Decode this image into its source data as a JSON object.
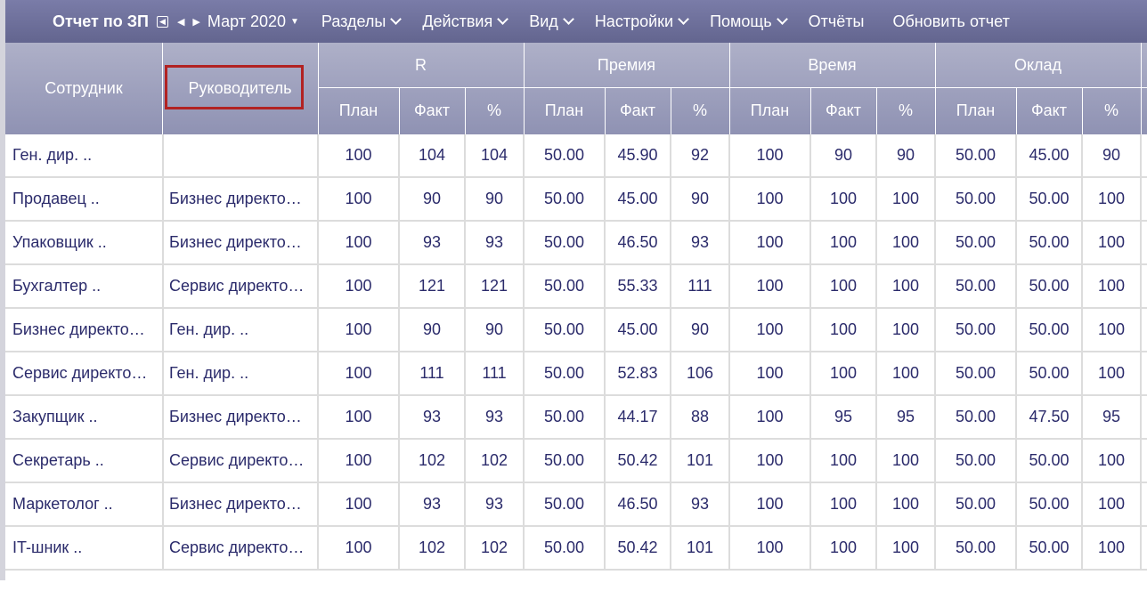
{
  "toolbar": {
    "title": "Отчет по ЗП",
    "period": "Март 2020",
    "menu": [
      "Разделы",
      "Действия",
      "Вид",
      "Настройки",
      "Помощь",
      "Отчёты",
      "Обновить отчет"
    ]
  },
  "header": {
    "employee": "Сотрудник",
    "manager": "Руководитель",
    "groups": [
      "R",
      "Премия",
      "Время",
      "Оклад"
    ],
    "sub": [
      "План",
      "Факт",
      "%"
    ]
  },
  "rows": [
    {
      "employee": "Ген. дир. ..",
      "manager": "",
      "vals": [
        "100",
        "104",
        "104",
        "50.00",
        "45.90",
        "92",
        "100",
        "90",
        "90",
        "50.00",
        "45.00",
        "90"
      ]
    },
    {
      "employee": "Продавец ..",
      "manager": "Бизнес директо…",
      "vals": [
        "100",
        "90",
        "90",
        "50.00",
        "45.00",
        "90",
        "100",
        "100",
        "100",
        "50.00",
        "50.00",
        "100"
      ]
    },
    {
      "employee": "Упаковщик ..",
      "manager": "Бизнес директо…",
      "vals": [
        "100",
        "93",
        "93",
        "50.00",
        "46.50",
        "93",
        "100",
        "100",
        "100",
        "50.00",
        "50.00",
        "100"
      ]
    },
    {
      "employee": "Бухгалтер ..",
      "manager": "Сервис директо…",
      "vals": [
        "100",
        "121",
        "121",
        "50.00",
        "55.33",
        "111",
        "100",
        "100",
        "100",
        "50.00",
        "50.00",
        "100"
      ]
    },
    {
      "employee": "Бизнес директо…",
      "manager": "Ген. дир. ..",
      "vals": [
        "100",
        "90",
        "90",
        "50.00",
        "45.00",
        "90",
        "100",
        "100",
        "100",
        "50.00",
        "50.00",
        "100"
      ]
    },
    {
      "employee": "Сервис директо…",
      "manager": "Ген. дир. ..",
      "vals": [
        "100",
        "111",
        "111",
        "50.00",
        "52.83",
        "106",
        "100",
        "100",
        "100",
        "50.00",
        "50.00",
        "100"
      ]
    },
    {
      "employee": "Закупщик ..",
      "manager": "Бизнес директо…",
      "vals": [
        "100",
        "93",
        "93",
        "50.00",
        "44.17",
        "88",
        "100",
        "95",
        "95",
        "50.00",
        "47.50",
        "95"
      ]
    },
    {
      "employee": "Секретарь ..",
      "manager": "Сервис директо…",
      "vals": [
        "100",
        "102",
        "102",
        "50.00",
        "50.42",
        "101",
        "100",
        "100",
        "100",
        "50.00",
        "50.00",
        "100"
      ]
    },
    {
      "employee": "Маркетолог ..",
      "manager": "Бизнес директо…",
      "vals": [
        "100",
        "93",
        "93",
        "50.00",
        "46.50",
        "93",
        "100",
        "100",
        "100",
        "50.00",
        "50.00",
        "100"
      ]
    },
    {
      "employee": "IT-шник ..",
      "manager": "Сервис директо…",
      "vals": [
        "100",
        "102",
        "102",
        "50.00",
        "50.42",
        "101",
        "100",
        "100",
        "100",
        "50.00",
        "50.00",
        "100"
      ]
    }
  ],
  "colors": {
    "header_top": "#aeb0c8",
    "header_bottom": "#8f92b3",
    "toolbar": "#6e709c",
    "text": "#2b2b6b",
    "highlight": "#b22222"
  }
}
